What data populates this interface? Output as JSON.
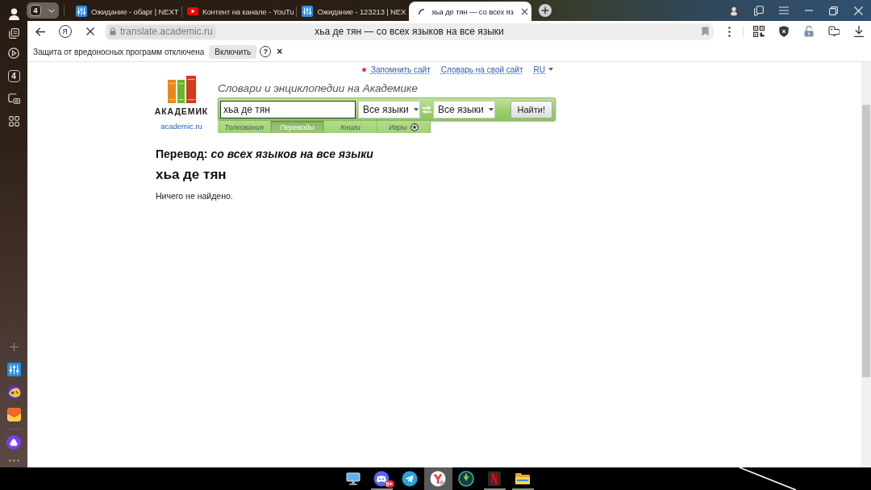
{
  "browser": {
    "tab_count": "4",
    "tabs": [
      {
        "kind": "site",
        "title": "Ожидание - обарг | NEXT",
        "selected": false
      },
      {
        "kind": "video",
        "title": "Контент на канале - YouTu",
        "selected": false
      },
      {
        "kind": "site",
        "title": "Ожидание - 123213 | NEX",
        "selected": false
      },
      {
        "kind": "loading",
        "title": "хьа де тян — со всех яз",
        "selected": true
      }
    ],
    "home_button": "Я",
    "address_bar": {
      "host": "translate.academic.ru",
      "title": "хьа де тян — со всех языков на все языки"
    },
    "infobar": {
      "message": "Защита от вредоносных программ отключена",
      "button": "Включить",
      "help": "?",
      "close": "×"
    }
  },
  "sidebar": {
    "tab_count": "4"
  },
  "page": {
    "top_links": [
      {
        "label": "Запомнить сайт",
        "starred": true
      },
      {
        "label": "Словарь на свой сайт",
        "starred": false
      }
    ],
    "language": "RU",
    "logo": {
      "wordmark": "АКАДЕМИК",
      "domain": "academic.ru"
    },
    "tagline": "Словари и энциклопедии на Академике",
    "search": {
      "value": "хьа де тян",
      "source_language": "Все языки",
      "target_language": "Все языки",
      "button": "Найти!"
    },
    "nav_tabs": [
      {
        "kind": "text",
        "label": "Толкования",
        "selected": false
      },
      {
        "kind": "text",
        "label": "Переводы",
        "selected": true
      },
      {
        "kind": "text",
        "label": "Книги",
        "selected": false
      },
      {
        "kind": "game",
        "label": "Игры",
        "selected": false
      }
    ],
    "heading": "Перевод: *со всех языков на все языки*",
    "query": "хьа де тян",
    "result": "Ничего не найдено."
  },
  "taskbar": {
    "apps": [
      {
        "kind": "monitor",
        "running": false,
        "selected": false
      },
      {
        "kind": "chat",
        "badge": "9+",
        "running": true,
        "selected": false
      },
      {
        "kind": "paper-plane",
        "running": false,
        "selected": false
      },
      {
        "kind": "y-browser",
        "running": false,
        "selected": true
      },
      {
        "kind": "ring",
        "running": false,
        "selected": false
      },
      {
        "kind": "n-tile",
        "running": true,
        "selected": false
      },
      {
        "kind": "folder",
        "running": true,
        "selected": false
      }
    ]
  }
}
